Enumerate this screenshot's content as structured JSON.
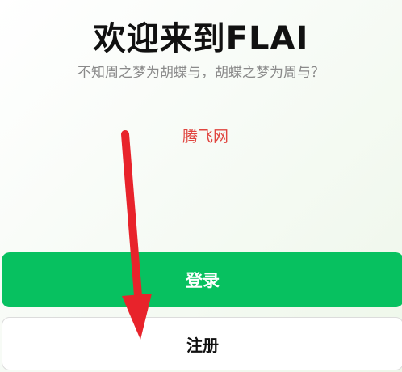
{
  "welcome": {
    "title": "欢迎来到FLAI",
    "subtitle": "不知周之梦为胡蝶与，胡蝶之梦为周与？"
  },
  "watermark": {
    "text": "腾飞网"
  },
  "buttons": {
    "login_label": "登录",
    "register_label": "注册"
  },
  "annotation": {
    "arrow_icon": "red-down-arrow-icon",
    "arrow_color": "#e8232b"
  },
  "colors": {
    "primary_green": "#07c160",
    "watermark_red": "#e0453f",
    "subtitle_gray": "#8a8a8a"
  }
}
